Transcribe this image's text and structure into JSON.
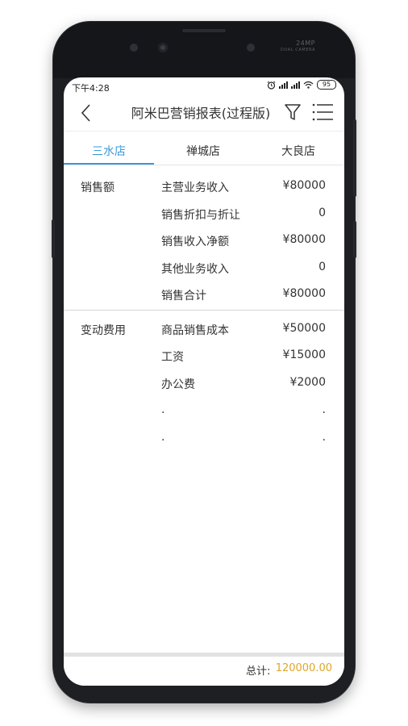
{
  "status": {
    "time": "下午4:28",
    "battery": "95"
  },
  "header": {
    "title": "阿米巴营销报表(过程版)"
  },
  "tabs": [
    {
      "label": "三水店",
      "active": true
    },
    {
      "label": "禅城店",
      "active": false
    },
    {
      "label": "大良店",
      "active": false
    }
  ],
  "sections": [
    {
      "label": "销售额",
      "rows": [
        {
          "name": "主营业务收入",
          "value": "¥80000"
        },
        {
          "name": "销售折扣与折让",
          "value": "0"
        },
        {
          "name": "销售收入净额",
          "value": "¥80000"
        },
        {
          "name": "其他业务收入",
          "value": "0"
        },
        {
          "name": "销售合计",
          "value": "¥80000"
        }
      ]
    },
    {
      "label": "变动费用",
      "rows": [
        {
          "name": "商品销售成本",
          "value": "¥50000"
        },
        {
          "name": "工资",
          "value": "¥15000"
        },
        {
          "name": "办公费",
          "value": "¥2000"
        },
        {
          "name": ".",
          "value": "."
        },
        {
          "name": ".",
          "value": "."
        }
      ]
    }
  ],
  "footer": {
    "total_label": "总计:",
    "total_value": "120000.00"
  },
  "device": {
    "camera_label": "24MP",
    "camera_sub": "DUAL CAMERA"
  },
  "colors": {
    "accent": "#3a9ad9",
    "total": "#e0a526"
  }
}
